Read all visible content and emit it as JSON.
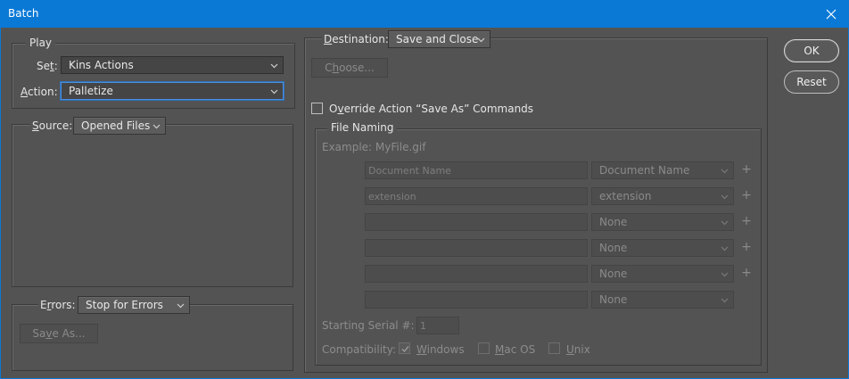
{
  "window": {
    "title": "Batch"
  },
  "play": {
    "legend": "Play",
    "set_label_pre": "Se",
    "set_label_ul": "t",
    "set_label_post": ":",
    "set_value": "Kins Actions",
    "action_label_ul": "A",
    "action_label_post": "ction:",
    "action_value": "Palletize"
  },
  "source": {
    "label_ul": "S",
    "label_post": "ource:",
    "value": "Opened Files"
  },
  "errors": {
    "label_pre": "E",
    "label_ul": "r",
    "label_post": "rors:",
    "value": "Stop for Errors",
    "save_as_label_pre": "Sa",
    "save_as_label_ul": "v",
    "save_as_label_post": "e As..."
  },
  "destination": {
    "label_ul": "D",
    "label_post": "estination:",
    "value": "Save and Close",
    "choose_label_pre": "C",
    "choose_label_ul": "h",
    "choose_label_post": "oose...",
    "override_label_pre": "O",
    "override_label_ul": "v",
    "override_label_post": "erride Action “Save As” Commands"
  },
  "file_naming": {
    "legend": "File Naming",
    "example": "Example: MyFile.gif",
    "rows": [
      {
        "text": "Document Name",
        "select": "Document Name",
        "plus": "+"
      },
      {
        "text": "extension",
        "select": "extension",
        "plus": "+"
      },
      {
        "text": "",
        "select": "None",
        "plus": "+"
      },
      {
        "text": "",
        "select": "None",
        "plus": "+"
      },
      {
        "text": "",
        "select": "None",
        "plus": "+"
      },
      {
        "text": "",
        "select": "None",
        "plus": ""
      }
    ],
    "serial_label": "Starting Serial #:",
    "serial_value": "1",
    "compat_label": "Compatibility:",
    "windows_label_ul": "W",
    "windows_label_post": "indows",
    "macos_label_ul": "M",
    "macos_label_post": "ac OS",
    "unix_label_ul": "U",
    "unix_label_post": "nix"
  },
  "buttons": {
    "ok": "OK",
    "reset": "Reset"
  }
}
